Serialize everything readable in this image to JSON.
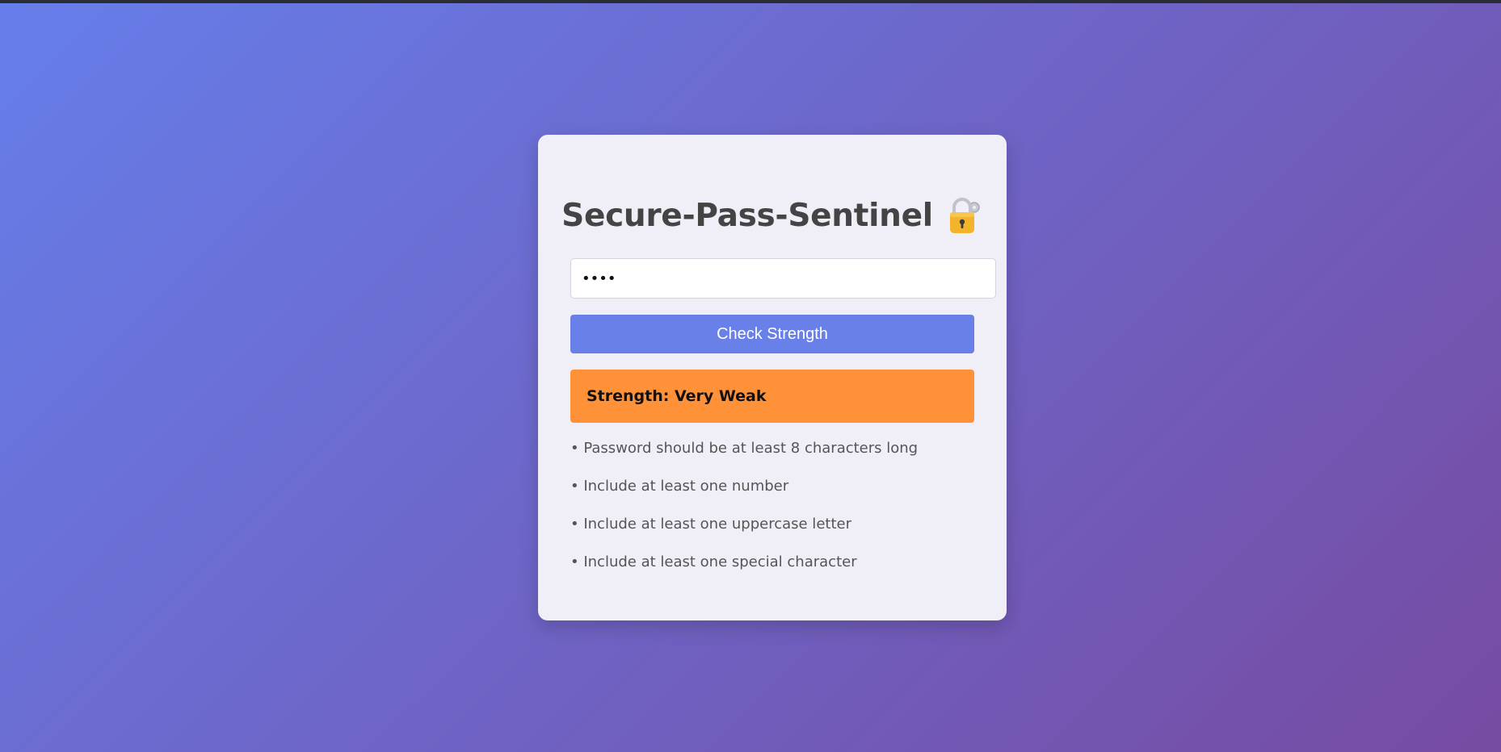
{
  "app": {
    "title": "Secure-Pass-Sentinel",
    "title_icon": "lock-with-key-icon"
  },
  "form": {
    "password_value": "••••",
    "check_button_label": "Check Strength"
  },
  "result": {
    "strength_label": "Strength: Very Weak",
    "color": "#ff9239"
  },
  "suggestions": [
    "• Password should be at least 8 characters long",
    "• Include at least one number",
    "• Include at least one uppercase letter",
    "• Include at least one special character"
  ],
  "colors": {
    "background_gradient_start": "#667eea",
    "background_gradient_end": "#764ba2",
    "button": "#6880e8",
    "card": "#f0eff8"
  }
}
